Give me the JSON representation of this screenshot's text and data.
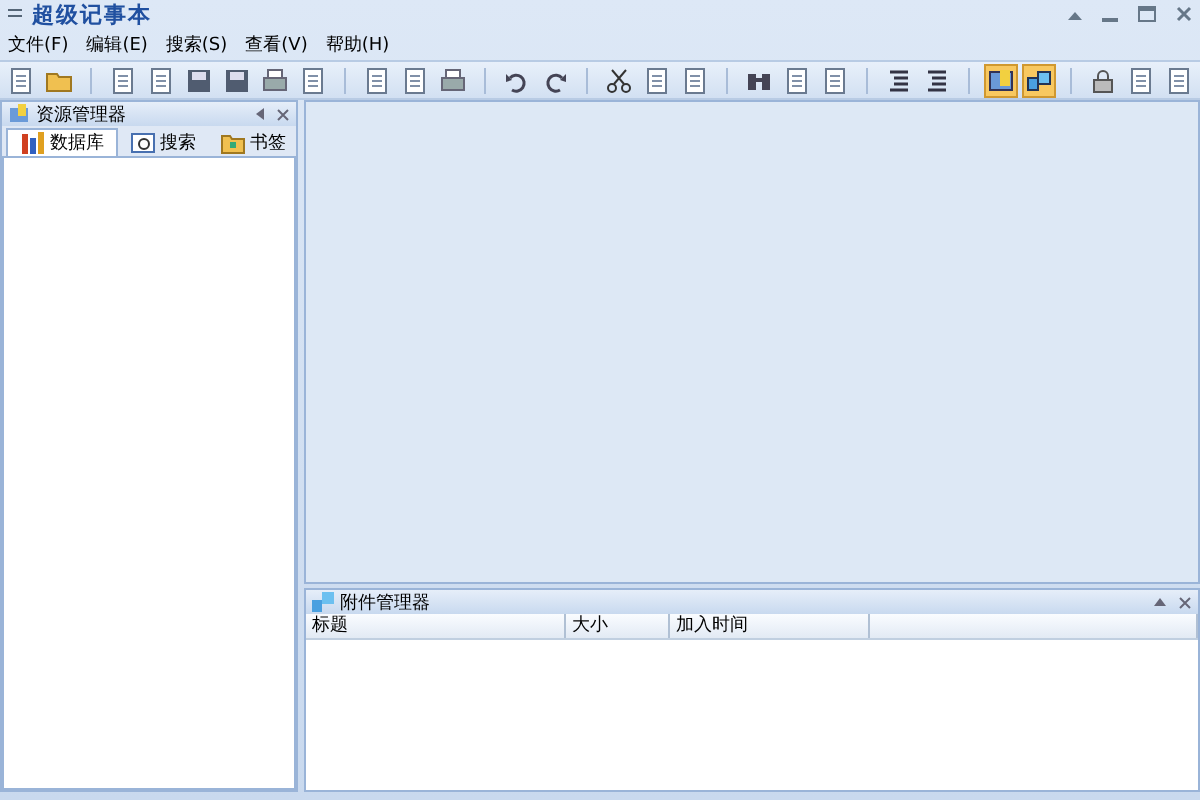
{
  "window": {
    "title": "超级记事本"
  },
  "menu": [
    {
      "label": "文件(F)"
    },
    {
      "label": "编辑(E)"
    },
    {
      "label": "搜索(S)"
    },
    {
      "label": "查看(V)"
    },
    {
      "label": "帮助(H)"
    }
  ],
  "toolbar": [
    [
      {
        "kind": "doc",
        "selected": false
      },
      {
        "kind": "folder",
        "selected": false
      }
    ],
    [
      {
        "kind": "doc",
        "selected": false
      },
      {
        "kind": "doc",
        "selected": false
      },
      {
        "kind": "disk",
        "selected": false
      },
      {
        "kind": "disk",
        "selected": false
      },
      {
        "kind": "printer",
        "selected": false
      },
      {
        "kind": "doc",
        "selected": false
      }
    ],
    [
      {
        "kind": "doc",
        "selected": false
      },
      {
        "kind": "doc",
        "selected": false
      },
      {
        "kind": "printer",
        "selected": false
      }
    ],
    [
      {
        "kind": "undo",
        "selected": false
      },
      {
        "kind": "redo",
        "selected": false
      }
    ],
    [
      {
        "kind": "scissors",
        "selected": false
      },
      {
        "kind": "doc",
        "selected": false
      },
      {
        "kind": "doc",
        "selected": false
      }
    ],
    [
      {
        "kind": "binoculars",
        "selected": false
      },
      {
        "kind": "doc",
        "selected": false
      },
      {
        "kind": "doc",
        "selected": false
      }
    ],
    [
      {
        "kind": "list",
        "selected": false
      },
      {
        "kind": "list",
        "selected": false
      }
    ],
    [
      {
        "kind": "panel",
        "selected": true
      },
      {
        "kind": "cubes",
        "selected": true
      }
    ],
    [
      {
        "kind": "lock",
        "selected": false
      },
      {
        "kind": "doc",
        "selected": false
      },
      {
        "kind": "doc",
        "selected": false
      }
    ]
  ],
  "explorer": {
    "title": "资源管理器",
    "tabs": [
      {
        "label": "数据库",
        "selected": true
      },
      {
        "label": "搜索",
        "selected": false
      },
      {
        "label": "书签",
        "selected": false
      }
    ]
  },
  "attachments": {
    "title": "附件管理器",
    "columns": [
      {
        "label": "标题"
      },
      {
        "label": "大小"
      },
      {
        "label": "加入时间"
      }
    ]
  }
}
